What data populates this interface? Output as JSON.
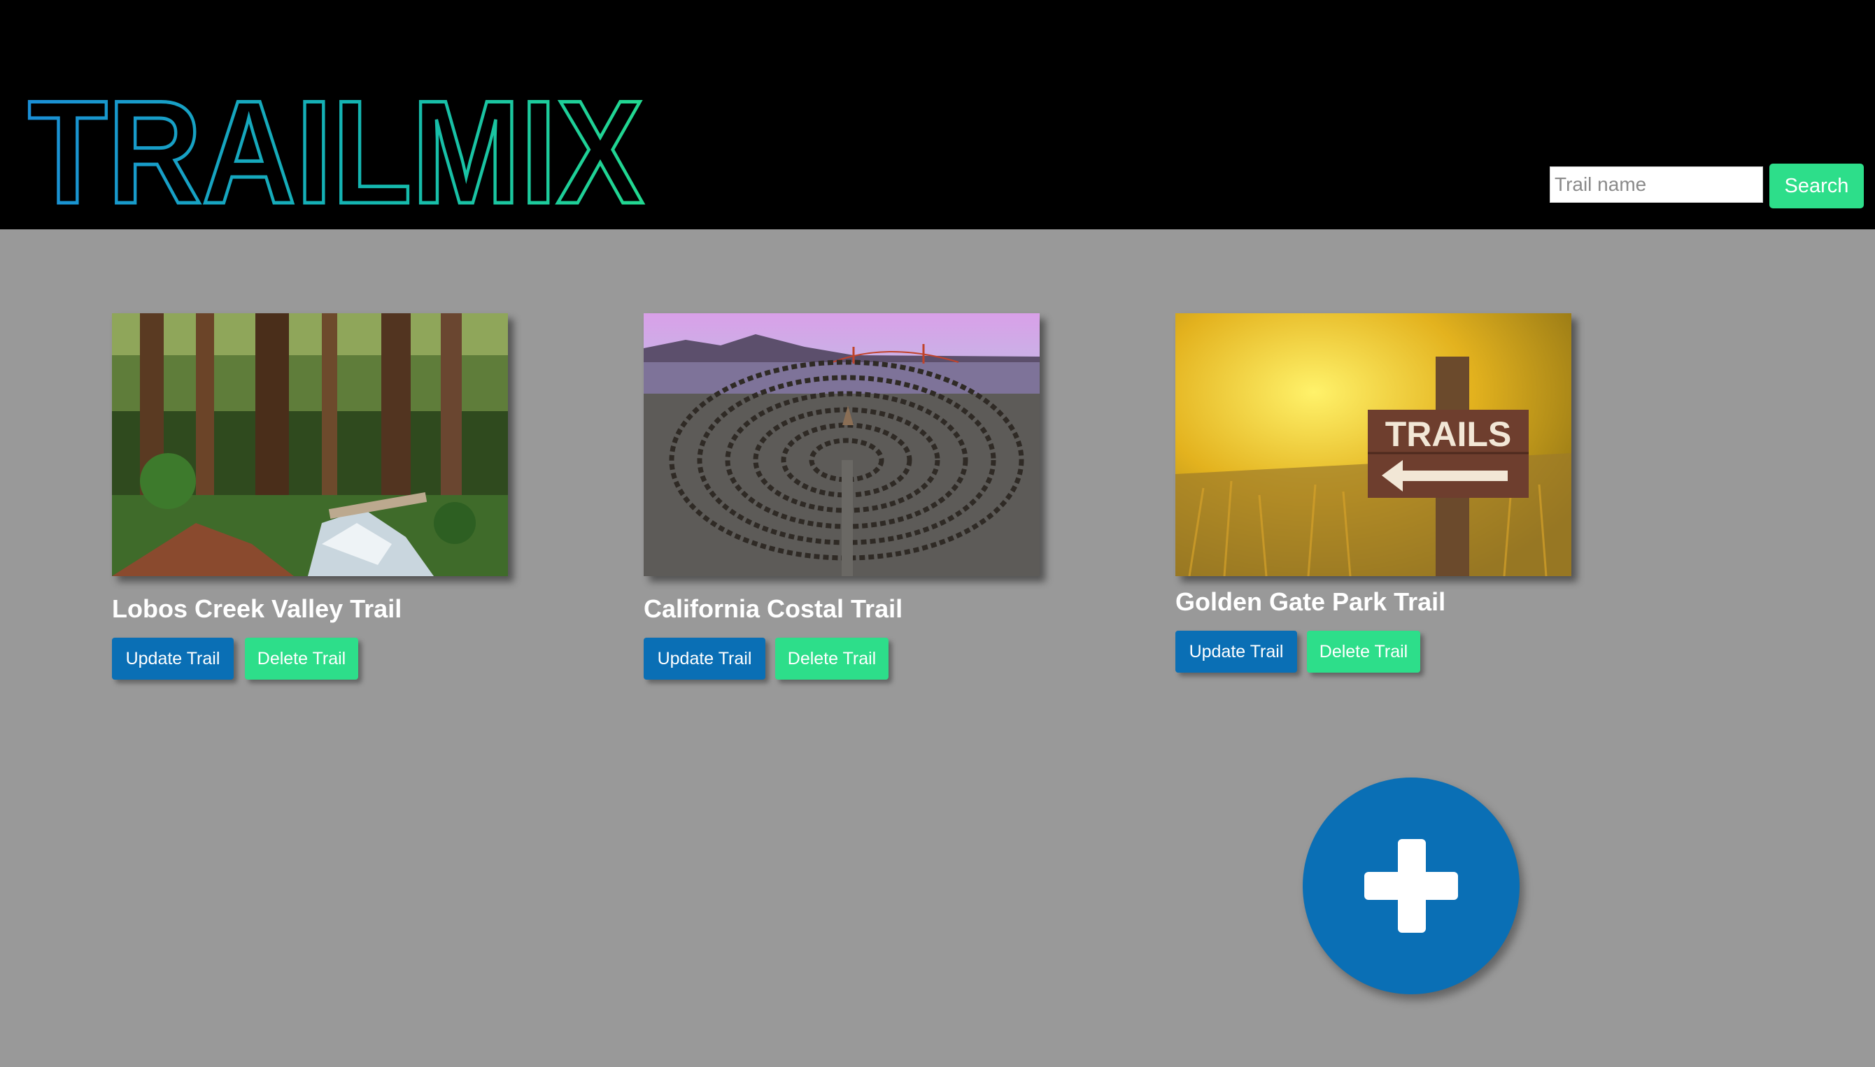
{
  "header": {
    "logo_text": "TRAILMIX",
    "search": {
      "placeholder": "Trail name",
      "value": "",
      "button_label": "Search"
    }
  },
  "trails": [
    {
      "title": "Lobos Creek Valley Trail",
      "image": "forest-creek-photo",
      "update_label": "Update Trail",
      "delete_label": "Delete Trail"
    },
    {
      "title": "California Costal Trail",
      "image": "labyrinth-golden-gate-photo",
      "update_label": "Update Trail",
      "delete_label": "Delete Trail"
    },
    {
      "title": "Golden Gate Park Trail",
      "image": "trails-sign-photo",
      "update_label": "Update Trail",
      "delete_label": "Delete Trail"
    }
  ],
  "add_button": {
    "icon": "plus-icon"
  },
  "colors": {
    "header_bg": "#000000",
    "page_bg": "#999999",
    "primary_blue": "#0a6fb5",
    "accent_green": "#2dde8a"
  }
}
